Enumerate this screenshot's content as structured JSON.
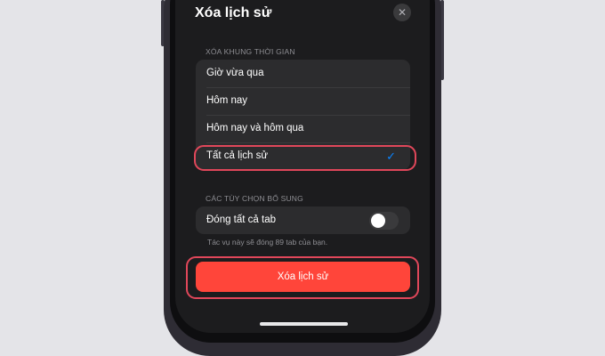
{
  "header": {
    "title": "Xóa lịch sử",
    "close_glyph": "✕"
  },
  "timeframe": {
    "section_label": "XÓA KHUNG THỜI GIAN",
    "options": [
      {
        "label": "Giờ vừa qua"
      },
      {
        "label": "Hôm nay"
      },
      {
        "label": "Hôm nay và hôm qua"
      },
      {
        "label": "Tất cả lịch sử",
        "check": "✓"
      }
    ],
    "selected_index": 3
  },
  "additional": {
    "section_label": "CÁC TÙY CHỌN BỔ SUNG",
    "close_tabs_label": "Đóng tất cả tab",
    "close_tabs_enabled": false,
    "note": "Tác vụ này sẽ đóng 89 tab của bạn."
  },
  "clear_button_label": "Xóa lịch sử",
  "colors": {
    "accent": "#0a84ff",
    "destructive": "#ff453a",
    "highlight_ring": "#e0475a"
  },
  "icons": {
    "close": "close-icon",
    "check": "checkmark-icon"
  }
}
